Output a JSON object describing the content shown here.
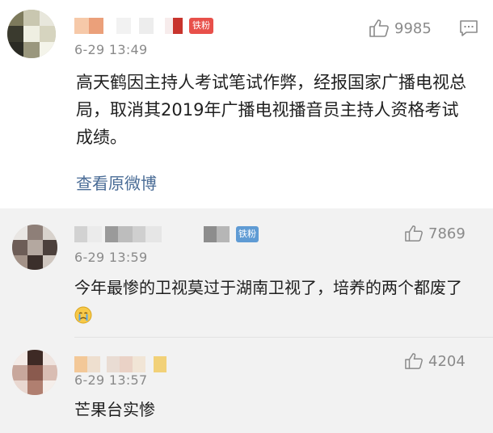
{
  "main_comment": {
    "badge": "铁粉",
    "time": "6-29 13:49",
    "likes": "9985",
    "body": "高天鹤因主持人考试笔试作弊，经报国家广播电视总局，取消其2019年广播电视播音员主持人资格考试成绩。",
    "view_original": "查看原微博",
    "colors": {
      "badge_bg": "#e8504a",
      "link": "#4a6c96"
    }
  },
  "replies": [
    {
      "badge": "铁粉",
      "time": "6-29 13:59",
      "likes": "7869",
      "body": "今年最惨的卫视莫过于湖南卫视了，培养的两个都废了",
      "emoji": "crying-face-emoji",
      "colors": {
        "badge_bg": "#5f9bd4"
      }
    },
    {
      "time": "6-29 13:57",
      "likes": "4204",
      "body": "芒果台实惨"
    }
  ]
}
